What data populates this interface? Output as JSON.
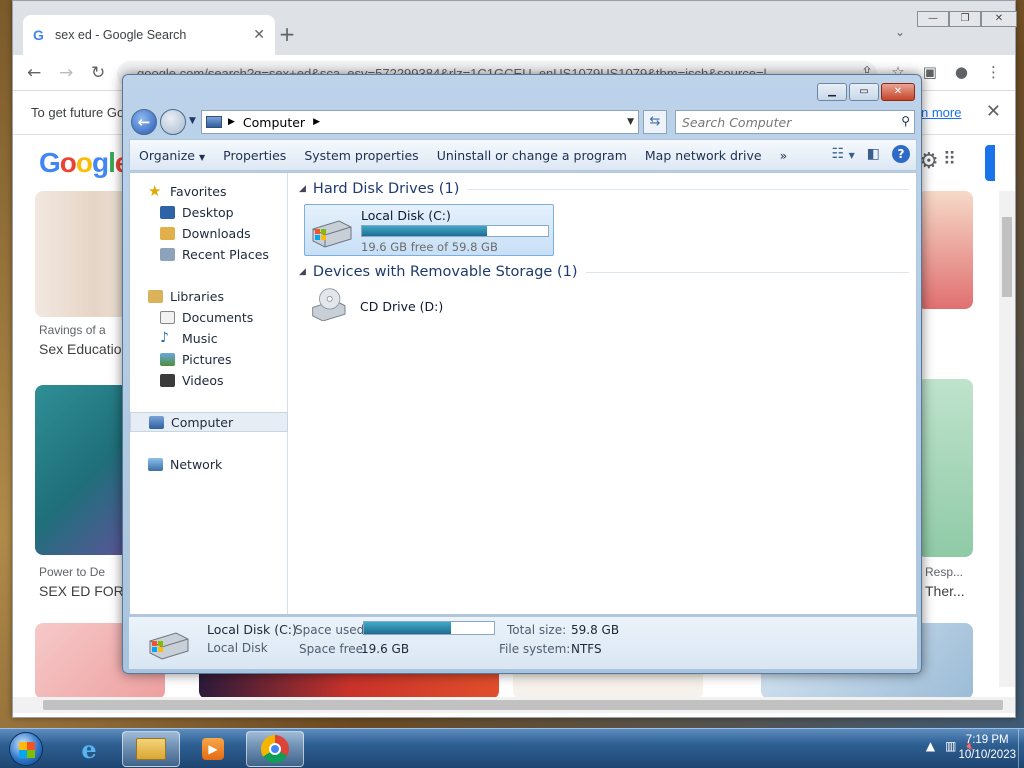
{
  "browser": {
    "tab_title": "sex ed - Google Search",
    "tab_close": "✕",
    "new_tab": "+",
    "url": "google.com/search?q=sex+ed&sca_esv=572299384&rlz=1C1GCEU_enUS1079US1079&tbm=isch&source=l",
    "infobar_text": "To get future Go",
    "infobar_link": "n more",
    "logo": "Google",
    "results": [
      {
        "source": "Ravings of a",
        "title": "Sex Educatio"
      },
      {
        "source": "Power to De",
        "title": "SEX ED FOR A"
      },
      {
        "source": "Resp...",
        "title": "Ther..."
      }
    ]
  },
  "explorer": {
    "address": "Computer",
    "search_placeholder": "Search Computer",
    "toolbar": {
      "organize": "Organize",
      "properties": "Properties",
      "system_properties": "System properties",
      "uninstall": "Uninstall or change a program",
      "map_drive": "Map network drive",
      "more": "»"
    },
    "nav": {
      "favorites": "Favorites",
      "desktop": "Desktop",
      "downloads": "Downloads",
      "recent": "Recent Places",
      "libraries": "Libraries",
      "documents": "Documents",
      "music": "Music",
      "pictures": "Pictures",
      "videos": "Videos",
      "computer": "Computer",
      "network": "Network"
    },
    "groups": {
      "hdd": "Hard Disk Drives (1)",
      "removable": "Devices with Removable Storage (1)"
    },
    "drives": {
      "c_name": "Local Disk (C:)",
      "c_free": "19.6 GB free of 59.8 GB",
      "c_used_fraction": 0.67,
      "d_name": "CD Drive (D:)"
    },
    "details": {
      "name": "Local Disk (C:)",
      "type": "Local Disk",
      "space_used_label": "Space used:",
      "space_free_label": "Space free:",
      "space_free": "19.6 GB",
      "total_label": "Total size:",
      "total": "59.8 GB",
      "fs_label": "File system:",
      "fs": "NTFS"
    }
  },
  "taskbar": {
    "time": "7:19 PM",
    "date": "10/10/2023"
  },
  "colors": {
    "accent": "#1a73e8",
    "bar_fill": "#2a86a8"
  }
}
